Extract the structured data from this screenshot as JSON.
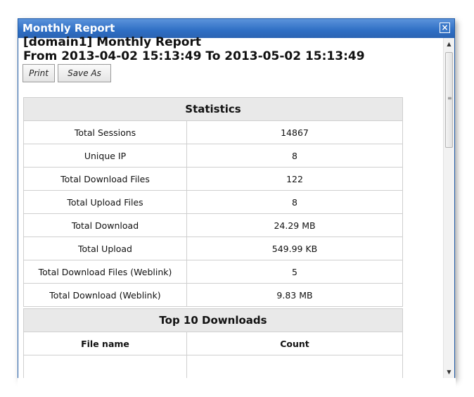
{
  "window": {
    "title": "Monthly Report",
    "close_symbol": "×"
  },
  "report": {
    "title": "[domain1] Monthly Report",
    "range": "From 2013-04-02 15:13:49 To 2013-05-02 15:13:49"
  },
  "buttons": {
    "print": "Print",
    "save_as": "Save As"
  },
  "statistics": {
    "header": "Statistics",
    "rows": [
      {
        "label": "Total Sessions",
        "value": "14867"
      },
      {
        "label": "Unique IP",
        "value": "8"
      },
      {
        "label": "Total Download Files",
        "value": "122"
      },
      {
        "label": "Total Upload Files",
        "value": "8"
      },
      {
        "label": "Total Download",
        "value": "24.29 MB"
      },
      {
        "label": "Total Upload",
        "value": "549.99 KB"
      },
      {
        "label": "Total Download Files (Weblink)",
        "value": "5"
      },
      {
        "label": "Total Download (Weblink)",
        "value": "9.83 MB"
      }
    ]
  },
  "top_downloads": {
    "header": "Top 10 Downloads",
    "columns": [
      "File name",
      "Count"
    ]
  }
}
